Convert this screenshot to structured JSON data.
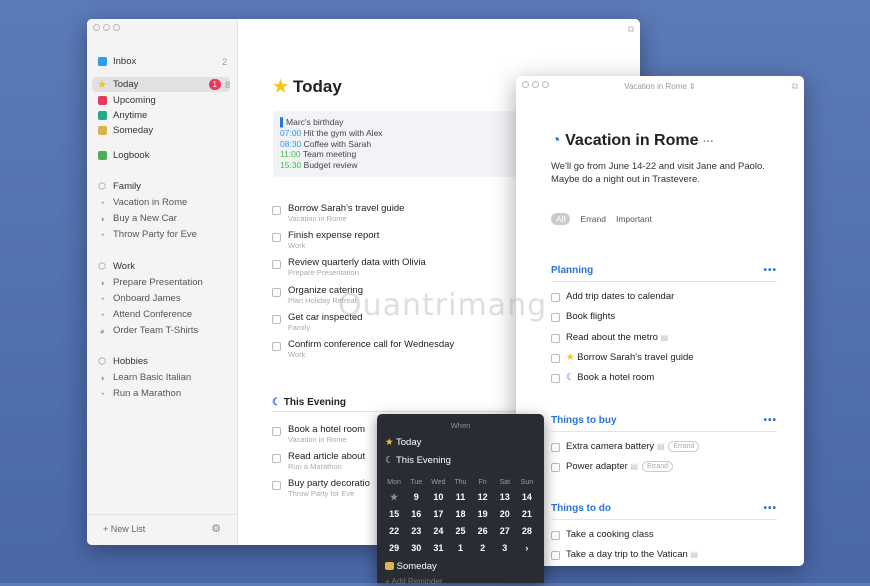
{
  "sidebar": {
    "inbox": {
      "label": "Inbox",
      "count": "2"
    },
    "today": {
      "label": "Today",
      "badge": "1",
      "count": "8"
    },
    "upcoming": "Upcoming",
    "anytime": "Anytime",
    "someday": "Someday",
    "logbook": "Logbook",
    "family": {
      "label": "Family",
      "items": [
        "Vacation in Rome",
        "Buy a New Car",
        "Throw Party for Eve"
      ]
    },
    "work": {
      "label": "Work",
      "items": [
        "Prepare Presentation",
        "Onboard James",
        "Attend Conference",
        "Order Team T-Shirts"
      ]
    },
    "hobbies": {
      "label": "Hobbies",
      "items": [
        "Learn Basic Italian",
        "Run a Marathon"
      ]
    },
    "new_list": "+ New List"
  },
  "today_view": {
    "title": "Today",
    "calendar": [
      {
        "time": "",
        "text": "Marc's birthday",
        "color": "#2a74d8"
      },
      {
        "time": "07:00",
        "text": "Hit the gym with Alex",
        "color": "#2a9ee8"
      },
      {
        "time": "08:30",
        "text": "Coffee with Sarah",
        "color": "#2a9ee8"
      },
      {
        "time": "11:00",
        "text": "Team meeting",
        "color": "#4cb84c"
      },
      {
        "time": "15:30",
        "text": "Budget review",
        "color": "#4cb84c"
      }
    ],
    "todos": [
      {
        "title": "Borrow Sarah's travel guide",
        "sub": "Vacation in Rome"
      },
      {
        "title": "Finish expense report",
        "sub": "Work"
      },
      {
        "title": "Review quarterly data with Olivia",
        "sub": "Prepare Presentation"
      },
      {
        "title": "Organize catering",
        "sub": "Plan Holiday Retreat"
      },
      {
        "title": "Get car inspected",
        "sub": "Family"
      },
      {
        "title": "Confirm conference call for Wednesday",
        "sub": "Work"
      }
    ],
    "evening_label": "This Evening",
    "evening": [
      {
        "title": "Book a hotel room",
        "sub": "Vacation in Rome"
      },
      {
        "title": "Read article about",
        "sub": "Run a Marathon"
      },
      {
        "title": "Buy party decoratio",
        "sub": "Throw Party for Eve"
      }
    ]
  },
  "project": {
    "window_title": "Vacation in Rome ⇕",
    "title": "Vacation in Rome",
    "more": "···",
    "notes": "We'll go from June 14-22 and visit Jane and Paolo. Maybe do a night out in Trastevere.",
    "filters": [
      "All",
      "Errand",
      "Important"
    ],
    "sections": [
      {
        "name": "Planning",
        "items": [
          "Add trip dates to calendar",
          "Book flights",
          "Read about the metro",
          "Borrow Sarah's travel guide",
          "Book a hotel room"
        ]
      },
      {
        "name": "Things to buy",
        "items": [
          "Extra camera battery",
          "Power adapter"
        ],
        "tag": "Errand"
      },
      {
        "name": "Things to do",
        "items": [
          "Take a cooking class",
          "Take a day trip to the Vatican"
        ]
      }
    ]
  },
  "when_popup": {
    "title": "When",
    "today": "Today",
    "evening": "This Evening",
    "days": [
      "Mon",
      "Tue",
      "Wed",
      "Thu",
      "Fri",
      "Sat",
      "Sun"
    ],
    "rows": [
      [
        "★",
        "9",
        "10",
        "11",
        "12",
        "13",
        "14"
      ],
      [
        "15",
        "16",
        "17",
        "18",
        "19",
        "20",
        "21"
      ],
      [
        "22",
        "23",
        "24",
        "25",
        "26",
        "27",
        "28"
      ],
      [
        "29",
        "30",
        "31",
        "1",
        "2",
        "3",
        "›"
      ]
    ],
    "someday": "Someday",
    "add_reminder": "+ Add Reminder"
  },
  "watermark": "Quantrimang"
}
